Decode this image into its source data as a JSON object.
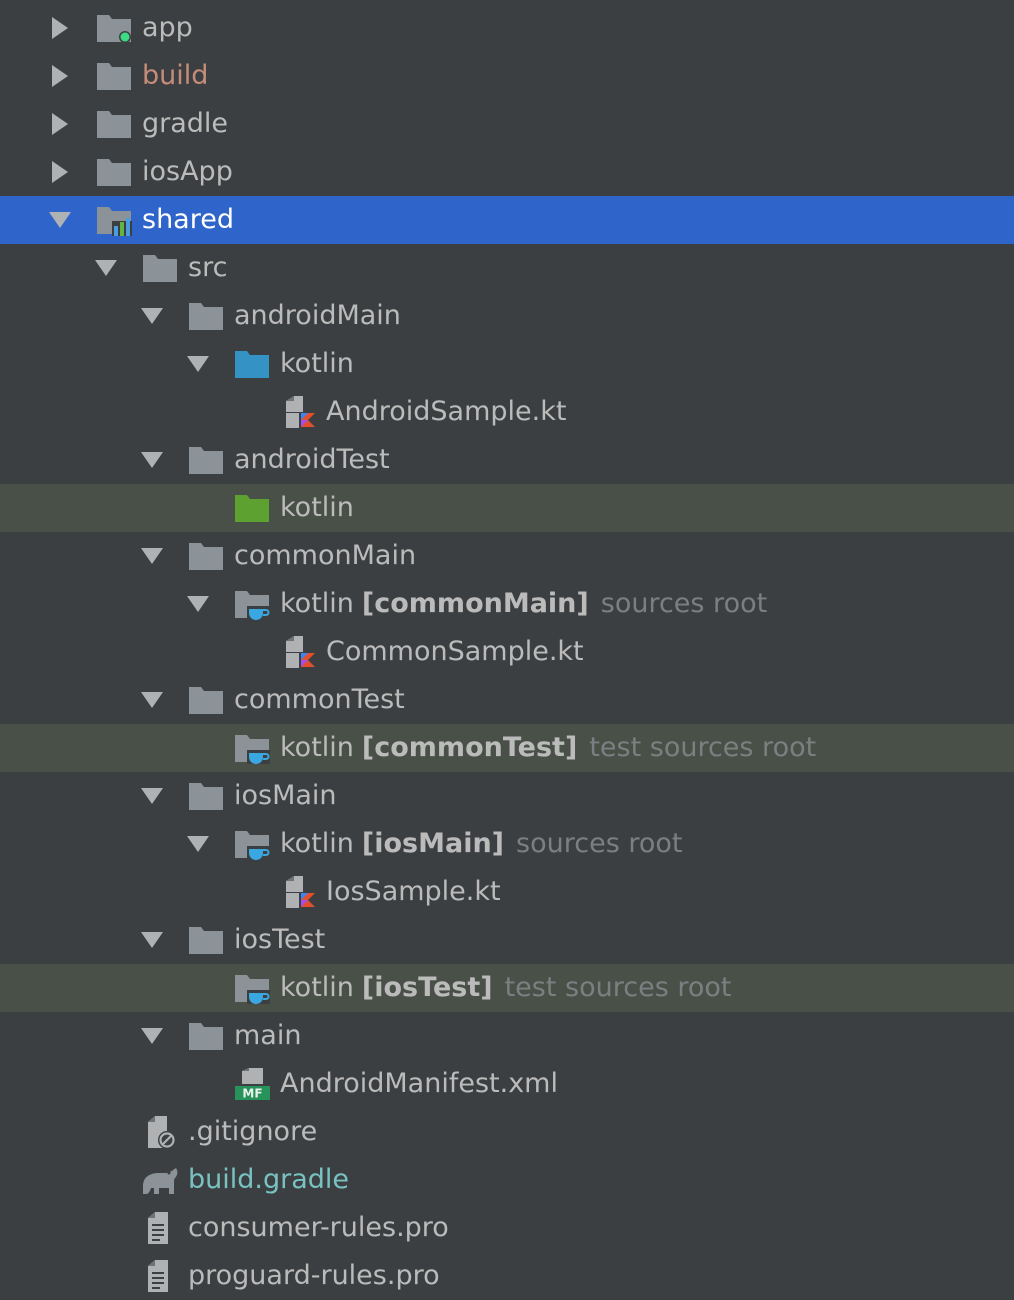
{
  "tree": {
    "nodes": [
      {
        "label": "app",
        "icon": "module-folder-icon",
        "expand": "collapsed"
      },
      {
        "label": "build",
        "icon": "folder-icon",
        "expand": "collapsed",
        "style": "build-dir"
      },
      {
        "label": "gradle",
        "icon": "folder-icon",
        "expand": "collapsed"
      },
      {
        "label": "iosApp",
        "icon": "folder-icon",
        "expand": "collapsed"
      },
      {
        "label": "shared",
        "icon": "shared-module-icon",
        "expand": "expanded",
        "selected": true
      },
      {
        "label": "src",
        "icon": "folder-icon",
        "expand": "expanded"
      },
      {
        "label": "androidMain",
        "icon": "folder-icon",
        "expand": "expanded"
      },
      {
        "label": "kotlin",
        "icon": "source-folder-icon",
        "expand": "expanded"
      },
      {
        "label": "AndroidSample.kt",
        "icon": "kotlin-file-icon",
        "expand": "none"
      },
      {
        "label": "androidTest",
        "icon": "folder-icon",
        "expand": "expanded"
      },
      {
        "label": "kotlin",
        "icon": "test-folder-icon",
        "expand": "none",
        "highlight": true
      },
      {
        "label": "commonMain",
        "icon": "folder-icon",
        "expand": "expanded"
      },
      {
        "label": "kotlin",
        "tag": "[commonMain]",
        "hint": "sources root",
        "icon": "source-root-icon",
        "expand": "expanded"
      },
      {
        "label": "CommonSample.kt",
        "icon": "kotlin-file-icon",
        "expand": "none"
      },
      {
        "label": "commonTest",
        "icon": "folder-icon",
        "expand": "expanded"
      },
      {
        "label": "kotlin",
        "tag": "[commonTest]",
        "hint": "test sources root",
        "icon": "source-root-icon",
        "expand": "none",
        "highlight": true
      },
      {
        "label": "iosMain",
        "icon": "folder-icon",
        "expand": "expanded"
      },
      {
        "label": "kotlin",
        "tag": "[iosMain]",
        "hint": "sources root",
        "icon": "source-root-icon",
        "expand": "expanded"
      },
      {
        "label": "IosSample.kt",
        "icon": "kotlin-file-icon",
        "expand": "none"
      },
      {
        "label": "iosTest",
        "icon": "folder-icon",
        "expand": "expanded"
      },
      {
        "label": "kotlin",
        "tag": "[iosTest]",
        "hint": "test sources root",
        "icon": "source-root-icon",
        "expand": "none",
        "highlight": true
      },
      {
        "label": "main",
        "icon": "folder-icon",
        "expand": "expanded"
      },
      {
        "label": "AndroidManifest.xml",
        "icon": "manifest-file-icon",
        "expand": "none"
      },
      {
        "label": ".gitignore",
        "icon": "ignored-file-icon",
        "expand": "none"
      },
      {
        "label": "build.gradle",
        "icon": "gradle-elephant-icon",
        "expand": "none",
        "style": "gradle-file"
      },
      {
        "label": "consumer-rules.pro",
        "icon": "text-file-icon",
        "expand": "none"
      },
      {
        "label": "proguard-rules.pro",
        "icon": "text-file-icon",
        "expand": "none"
      }
    ]
  },
  "colors": {
    "background": "#3c3f41",
    "selection": "#2f65ca",
    "row_highlight": "#495047",
    "text": "#bbbbbb",
    "hint": "#7c7f81",
    "build_dir": "#c58c7a",
    "gradle_file": "#79c2c2"
  }
}
